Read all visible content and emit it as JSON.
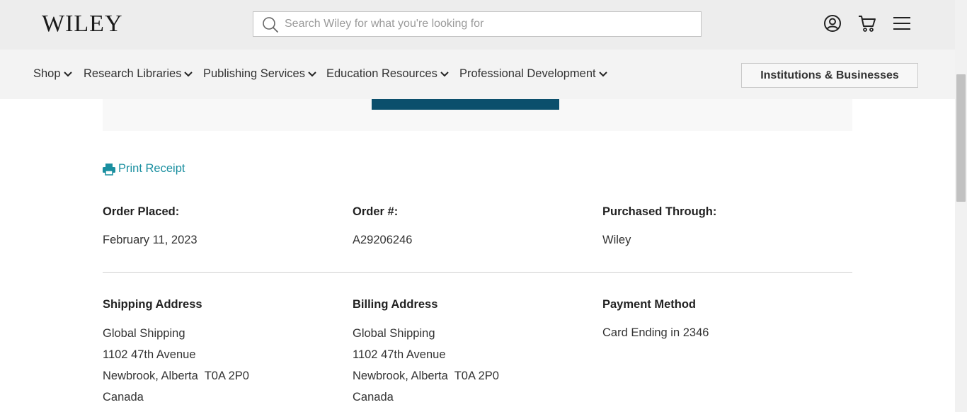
{
  "header": {
    "logo": "WILEY",
    "search_placeholder": "Search Wiley for what you're looking for",
    "icons": [
      "account-icon",
      "cart-icon",
      "menu-icon"
    ]
  },
  "nav": {
    "items": [
      "Shop",
      "Research Libraries",
      "Publishing Services",
      "Education Resources",
      "Professional Development"
    ],
    "institutions_button": "Institutions & Businesses"
  },
  "order": {
    "print_label": "Print Receipt",
    "placed_label": "Order Placed:",
    "placed_value": "February 11, 2023",
    "number_label": "Order #:",
    "number_value": "A29206246",
    "through_label": "Purchased Through:",
    "through_value": "Wiley"
  },
  "shipping": {
    "label": "Shipping Address",
    "lines": [
      "Global Shipping",
      "1102 47th Avenue",
      "Newbrook, Alberta  T0A 2P0",
      "Canada"
    ]
  },
  "billing": {
    "label": "Billing Address",
    "lines": [
      "Global Shipping",
      "1102 47th Avenue",
      "Newbrook, Alberta  T0A 2P0",
      "Canada"
    ]
  },
  "payment": {
    "label": "Payment Method",
    "value": "Card Ending in 2346"
  },
  "colors": {
    "accent_link": "#1a8fa0",
    "primary_button": "#0b4f6c",
    "topbar": "#ededed",
    "navbar": "#f3f3f3"
  }
}
